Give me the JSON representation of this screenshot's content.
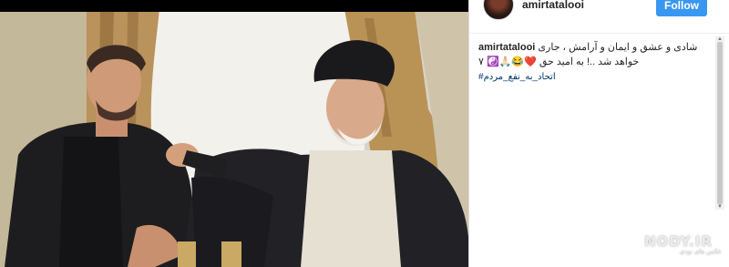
{
  "post": {
    "username": "amirtatalooi",
    "follow_label": "Follow",
    "caption_user": "amirtatalooi",
    "caption_text": "شادی و عشق و ایمان و آرامش ، جاری خواهد شد ..! به امید حق ❤️😂🙏🏻☯️ ۷",
    "hashtag": "#اتحاد_به_نفع_مردم"
  },
  "watermark": {
    "main": "NODY.IR",
    "sub": "عکس های نودی"
  },
  "colors": {
    "follow_bg": "#3897f0",
    "hashtag": "#003569",
    "text": "#262626"
  },
  "icons": {
    "avatar": "profile-avatar",
    "scroll": "scrollbar"
  }
}
